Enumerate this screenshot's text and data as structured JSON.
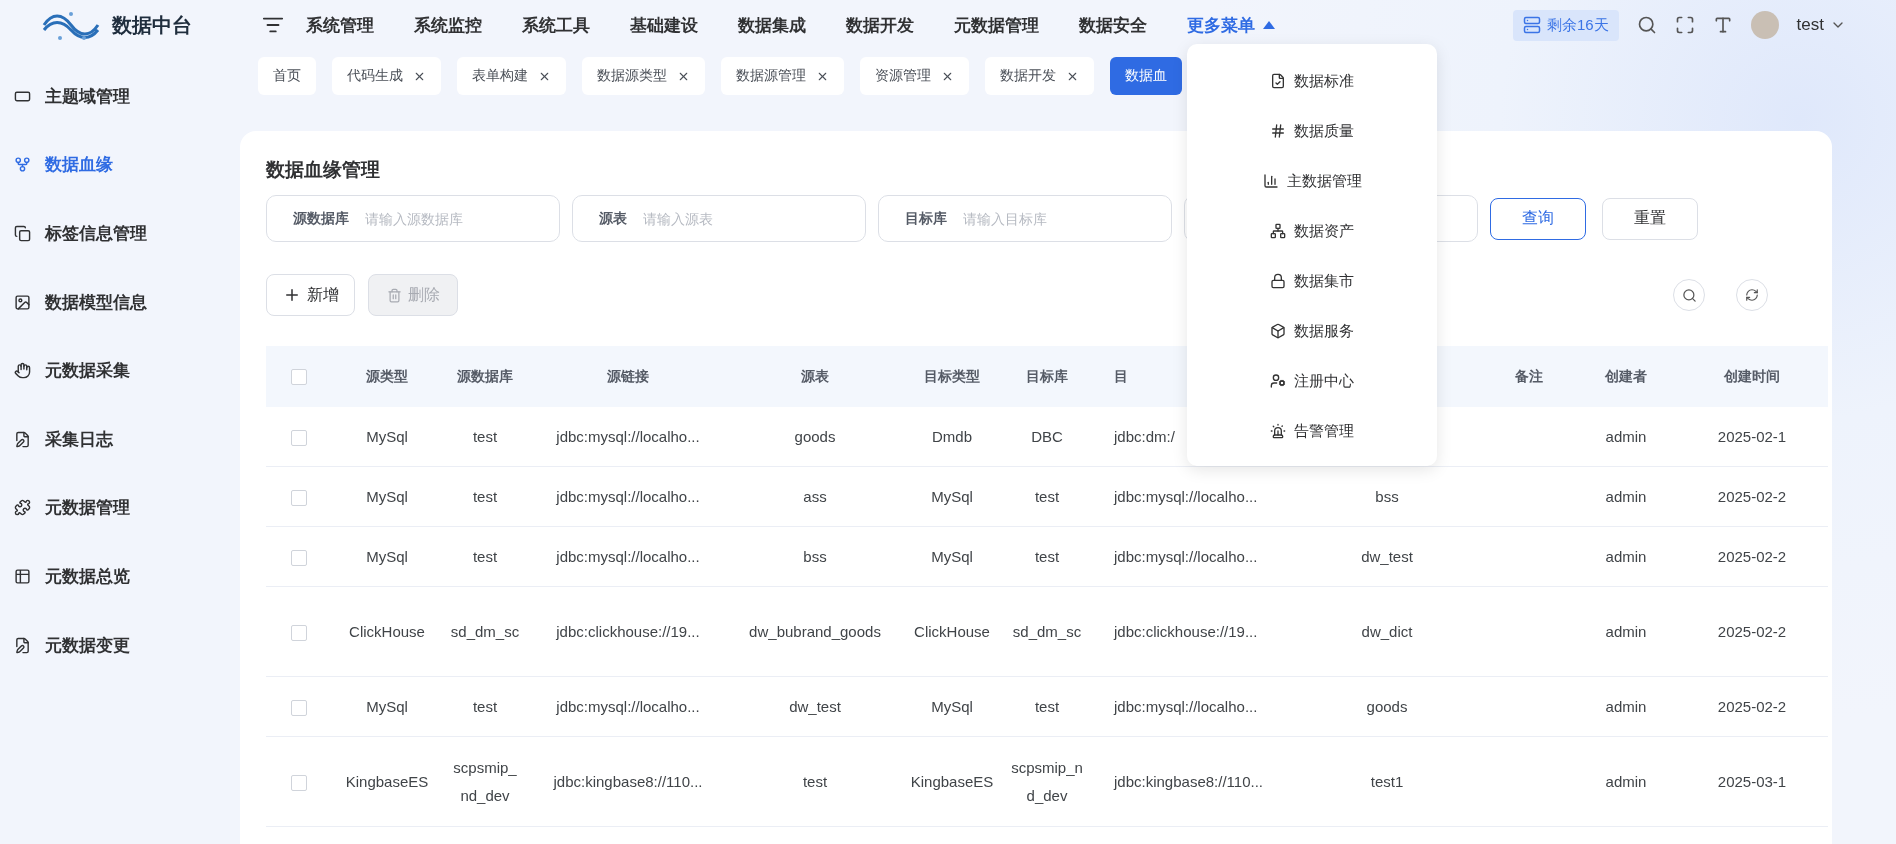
{
  "app": {
    "title": "数据中台"
  },
  "nav": {
    "items": [
      "系统管理",
      "系统监控",
      "系统工具",
      "基础建设",
      "数据集成",
      "数据开发",
      "元数据管理",
      "数据安全"
    ],
    "more": {
      "label": "更多菜单",
      "expanded": true,
      "items": [
        "数据标准",
        "数据质量",
        "主数据管理",
        "数据资产",
        "数据集市",
        "数据服务",
        "注册中心",
        "告警管理"
      ]
    }
  },
  "header_right": {
    "license": "剩余16天",
    "user": "test"
  },
  "sidebar": {
    "items": [
      {
        "label": "主题域管理",
        "selected": false
      },
      {
        "label": "数据血缘",
        "selected": true
      },
      {
        "label": "标签信息管理",
        "selected": false
      },
      {
        "label": "数据模型信息",
        "selected": false
      },
      {
        "label": "元数据采集",
        "selected": false
      },
      {
        "label": "采集日志",
        "selected": false
      },
      {
        "label": "元数据管理",
        "selected": false
      },
      {
        "label": "元数据总览",
        "selected": false
      },
      {
        "label": "元数据变更",
        "selected": false
      }
    ]
  },
  "tabs": [
    {
      "label": "首页",
      "closable": false,
      "selected": false
    },
    {
      "label": "代码生成",
      "closable": true,
      "selected": false
    },
    {
      "label": "表单构建",
      "closable": true,
      "selected": false
    },
    {
      "label": "数据源类型",
      "closable": true,
      "selected": false
    },
    {
      "label": "数据源管理",
      "closable": true,
      "selected": false
    },
    {
      "label": "资源管理",
      "closable": true,
      "selected": false
    },
    {
      "label": "数据开发",
      "closable": true,
      "selected": false
    },
    {
      "label": "数据血",
      "closable": false,
      "selected": true
    }
  ],
  "page": {
    "title": "数据血缘管理",
    "filters": [
      {
        "label": "源数据库",
        "placeholder": "请输入源数据库"
      },
      {
        "label": "源表",
        "placeholder": "请输入源表"
      },
      {
        "label": "目标库",
        "placeholder": "请输入目标库"
      }
    ],
    "search_button": "查询",
    "reset_button": "重置",
    "add_button": "新增",
    "delete_button": {
      "label": "删除",
      "disabled": true
    }
  },
  "table": {
    "all_checked": false,
    "columns": [
      "源类型",
      "源数据库",
      "源链接",
      "源表",
      "目标类型",
      "目标库",
      "目",
      null,
      "备注",
      "创建者",
      "创建时间"
    ],
    "rows": [
      {
        "checked": false,
        "cells": [
          "MySql",
          "test",
          "jdbc:mysql://localho...",
          "goods",
          "Dmdb",
          "DBC",
          "jdbc:dm:/",
          null,
          null,
          "admin",
          "2025-02-1"
        ]
      },
      {
        "checked": false,
        "cells": [
          "MySql",
          "test",
          "jdbc:mysql://localho...",
          "ass",
          "MySql",
          "test",
          "jdbc:mysql://localho...",
          "bss",
          null,
          "admin",
          "2025-02-2"
        ]
      },
      {
        "checked": false,
        "cells": [
          "MySql",
          "test",
          "jdbc:mysql://localho...",
          "bss",
          "MySql",
          "test",
          "jdbc:mysql://localho...",
          "dw_test",
          null,
          "admin",
          "2025-02-2"
        ]
      },
      {
        "checked": false,
        "cells": [
          "ClickHouse",
          "sd_dm_sc",
          "jdbc:clickhouse://19...",
          "dw_bubrand_goods",
          "ClickHouse",
          "sd_dm_sc",
          "jdbc:clickhouse://19...",
          "dw_dict",
          null,
          "admin",
          "2025-02-2"
        ]
      },
      {
        "checked": false,
        "cells": [
          "MySql",
          "test",
          "jdbc:mysql://localho...",
          "dw_test",
          "MySql",
          "test",
          "jdbc:mysql://localho...",
          "goods",
          null,
          "admin",
          "2025-02-2"
        ]
      },
      {
        "checked": false,
        "cells": [
          "KingbaseES",
          "scpsmip_nd_dev",
          "jdbc:kingbase8://110...",
          "test",
          "KingbaseES",
          "scpsmip_nd_dev",
          "jdbc:kingbase8://110...",
          "test1",
          null,
          "admin",
          "2025-03-1"
        ]
      }
    ]
  }
}
